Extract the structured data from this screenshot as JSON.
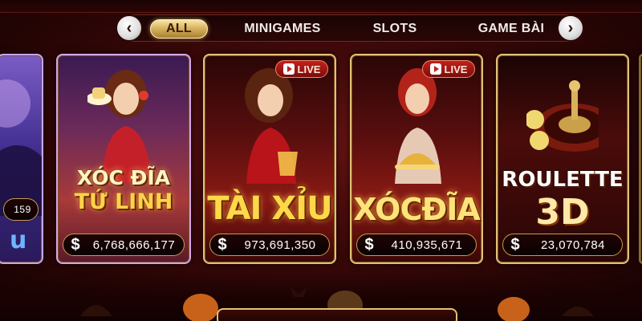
{
  "tabs": {
    "prev_icon": "chevron-left-icon",
    "next_icon": "chevron-right-icon",
    "items": [
      "ALL",
      "MINIGAMES",
      "SLOTS",
      "GAME BÀI"
    ],
    "active": "ALL"
  },
  "cards": [
    {
      "name": "partial-left",
      "jackpot": "159"
    },
    {
      "name": "xoc-dia-tu-linh",
      "title_line1": "XÓC ĐĨA",
      "title_line2": "TỨ LINH",
      "jackpot": "6,768,666,177",
      "live": false
    },
    {
      "name": "tai-xiu",
      "title_line1": "TÀI XỈU",
      "title_line2": "",
      "jackpot": "973,691,350",
      "live": true,
      "live_label": "LIVE"
    },
    {
      "name": "xoc-dia",
      "title_line1": "XÓCĐĨA",
      "title_line2": "",
      "jackpot": "410,935,671",
      "live": true,
      "live_label": "LIVE"
    },
    {
      "name": "roulette-3d",
      "title_line1": "ROULETTE",
      "title_line2": "3D",
      "jackpot": "23,070,784",
      "live": false
    }
  ],
  "currency_symbol": "$",
  "colors": {
    "accent_gold": "#e2c176",
    "background": "#3a0808",
    "live_red": "#c2211c"
  }
}
